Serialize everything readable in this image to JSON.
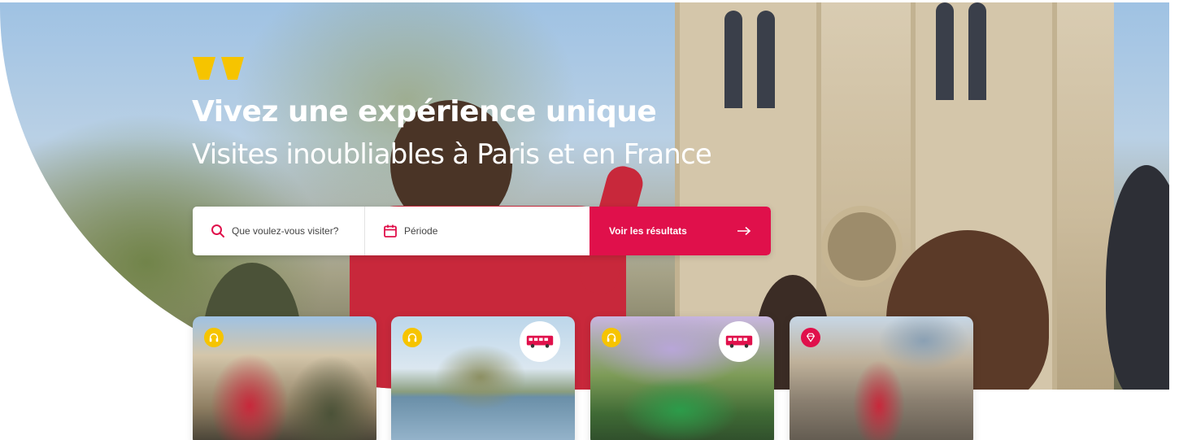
{
  "hero": {
    "quote_icon": "quote-icon",
    "title": "Vivez une expérience unique",
    "subtitle": "Visites inoubliables à Paris et en France"
  },
  "search": {
    "what_placeholder": "Que voulez-vous visiter?",
    "when_placeholder": "Période",
    "submit_label": "Voir les résultats",
    "search_icon": "search-icon",
    "calendar_icon": "calendar-icon",
    "arrow_icon": "arrow-right-icon"
  },
  "cards": [
    {
      "name": "notre-dame-tour",
      "badges": [
        "headphones-icon"
      ]
    },
    {
      "name": "mont-saint-michel-tour",
      "badges": [
        "headphones-icon",
        "bus-icon"
      ]
    },
    {
      "name": "giverny-tour",
      "badges": [
        "headphones-icon",
        "bus-icon"
      ]
    },
    {
      "name": "louvre-bike-tour",
      "badges": [
        "diamond-icon"
      ]
    }
  ],
  "colors": {
    "accent": "#e0104b",
    "yellow": "#f6c400",
    "white": "#ffffff"
  }
}
